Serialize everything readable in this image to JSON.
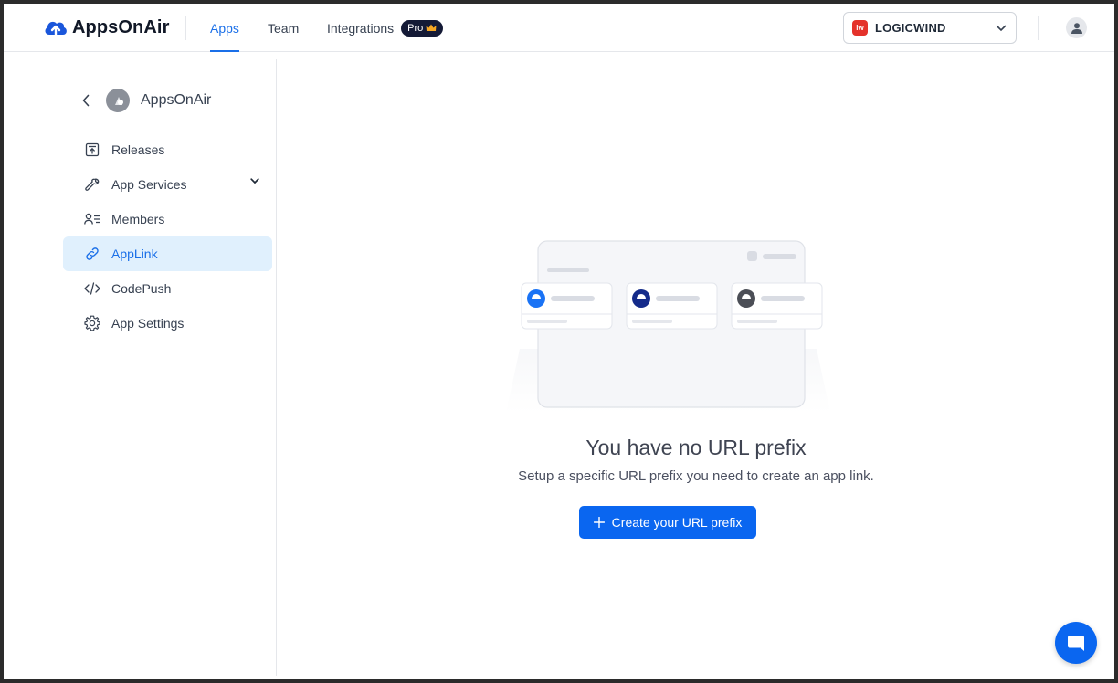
{
  "header": {
    "brand": "AppsOnAir",
    "nav": [
      {
        "label": "Apps"
      },
      {
        "label": "Team"
      },
      {
        "label": "Integrations"
      }
    ],
    "pro_badge": "Pro",
    "org": {
      "name": "LOGICWIND",
      "logo_text": "lw"
    }
  },
  "sidebar": {
    "app_name": "AppsOnAir",
    "items": [
      {
        "label": "Releases",
        "icon": "upload-box-icon"
      },
      {
        "label": "App Services",
        "icon": "wrench-icon"
      },
      {
        "label": "Members",
        "icon": "members-icon"
      },
      {
        "label": "AppLink",
        "icon": "link-icon",
        "active": true
      },
      {
        "label": "CodePush",
        "icon": "code-icon"
      },
      {
        "label": "App Settings",
        "icon": "gear-icon"
      }
    ]
  },
  "empty_state": {
    "title": "You have no URL prefix",
    "subtitle": "Setup a specific URL prefix you need to create an app link.",
    "button_label": "Create your URL prefix"
  },
  "colors": {
    "accent": "#0a66f0",
    "active_bg": "#e0f0fd",
    "org_logo": "#e4322b",
    "pro_badge": "#141a36"
  }
}
